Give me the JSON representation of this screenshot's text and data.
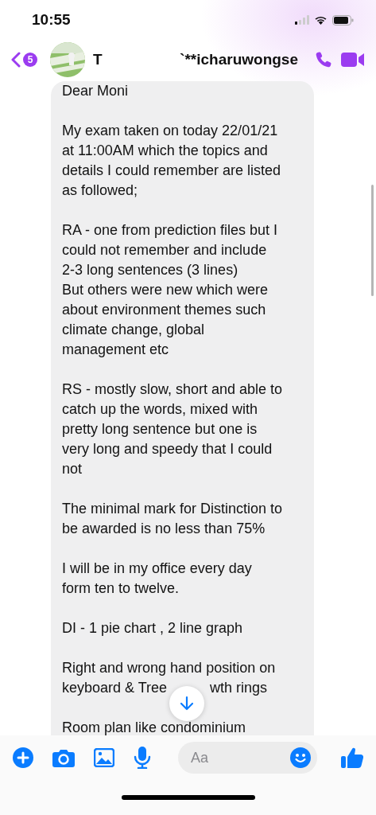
{
  "status_bar": {
    "time": "10:55"
  },
  "header": {
    "back_badge": "5",
    "name_parts": [
      "T",
      "`**icharuwongse"
    ]
  },
  "message": {
    "paragraphs": [
      [
        "Dear Moni"
      ],
      [
        "My exam taken on today 22/01/21",
        "at 11:00AM which the topics and",
        "details I could remember are listed",
        "as followed;"
      ],
      [
        "RA - one from prediction files but I",
        "could not remember and include",
        "2-3 long sentences (3 lines)",
        "But others were new which were",
        "about environment themes such",
        "climate change, global",
        "management etc"
      ],
      [
        "RS - mostly slow, short and able to",
        "catch up the words, mixed with",
        "pretty long sentence but one is",
        "very long and speedy that I could",
        "not"
      ],
      [
        "The minimal mark for Distinction to",
        "be awarded is no less than 75%"
      ],
      [
        "I will be in my office every day",
        "form ten to twelve."
      ],
      [
        "DI - 1 pie chart , 2 line graph"
      ],
      [
        "Right and wrong hand position on",
        [
          "keyboard & Tree",
          "wth rings"
        ]
      ],
      [
        "Room plan like condominium"
      ]
    ]
  },
  "composer": {
    "placeholder": "Aa"
  }
}
